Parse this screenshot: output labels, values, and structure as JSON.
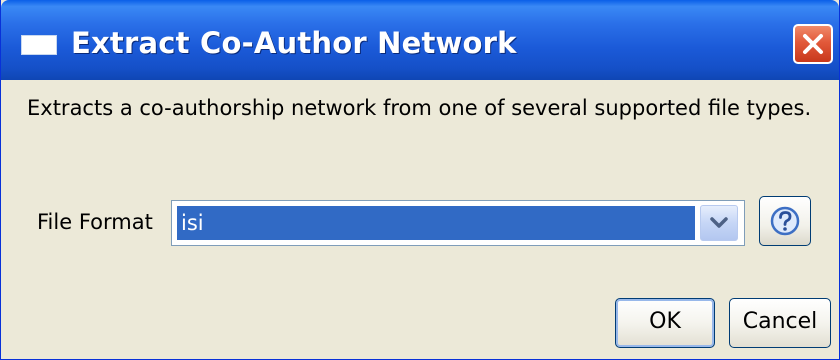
{
  "window": {
    "title": "Extract Co-Author Network",
    "icon": "window-icon",
    "close_icon": "close-icon"
  },
  "description": "Extracts a co-authorship network from one of several supported file types.",
  "form": {
    "file_format_label": "File Format",
    "file_format_value": "isi",
    "dropdown_icon": "chevron-down-icon",
    "help_icon": "help-icon"
  },
  "buttons": {
    "ok": "OK",
    "cancel": "Cancel"
  },
  "colors": {
    "titlebar": "#0a5fe8",
    "selection": "#316ac5",
    "close": "#e2593a",
    "dialog_bg": "#ece9d8"
  }
}
